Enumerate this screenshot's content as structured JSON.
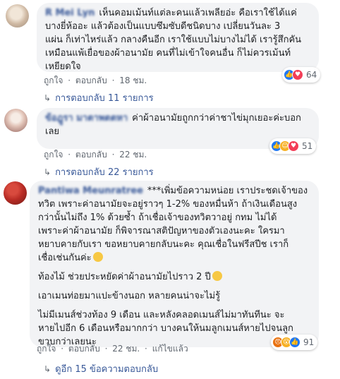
{
  "comments": [
    {
      "author": "R Mei Lyn",
      "lines": [
        "เห็นคอมเม้นท์แต่ละคนแล้วเพลียอ่ะ คือเราใช้ได้แค่",
        "บางยี่ห้ออะ แล้วต้องเป็นแบบซึมซับดีชนิดบาง เปลี่ยนวันละ 3",
        "แผ่น ก็เท่าไหร่แล้ว กลางคืนอีก เราใช้แบบไม่บางไม่ได้ เรารู้สึกคัน",
        "เหมือนแพ้เยื่อของผ้าอนามัย คนที่ไม่เข้าใจคนอื่น ก็ไม่ควรเม้นท์",
        "เหยียดใจ"
      ],
      "meta": [
        "ถูกใจ",
        "·",
        "ตอบกลับ",
        "·",
        "18 ชม."
      ],
      "reactions": {
        "count": "64",
        "icons": [
          "like-icon",
          "love-icon"
        ]
      },
      "reply_link": "การตอบกลับ 11 รายการ"
    },
    {
      "author": "ข้อฎูรา มาตาพตตหา",
      "lines": [
        "ค่าผ้าอนามัยถูกกว่าค่าชาไข่มุกเยอะค่ะบอก",
        "เลย"
      ],
      "meta": [
        "ถูกใจ",
        "·",
        "ตอบกลับ",
        "·",
        "22 ชม."
      ],
      "reactions": {
        "count": "51",
        "icons": [
          "like-icon",
          "haha-icon",
          "love-icon"
        ]
      },
      "reply_link": "การตอบกลับ 22 รายการ"
    },
    {
      "author": "Pantiwa Meunratree",
      "paragraphs": [
        [
          "***เพิ่มข้อความหน่อย เราประชดเจ้าของ",
          "ทวิต เพราะค่าอนามัยจะอยู่ราวๆ 1-2% ของหมื่นห้า ถ้าเงินเดือนสูง",
          "กว่านั้นไม่ถึง 1% ด้วยซ้ำ ถ้าเชื่อเจ้าของทวิตวาอยู่ กทม ไม่ได้",
          "เพราะค่าผ้าอนามัย ก็พิจารณาสติปัญหาของตัวเองนะคะ ใครมา",
          "หยาบคายกับเรา ขอหยาบคายกลับนะคะ คุณเชื่อในฟรีสปีช เราก็",
          "เชื่อเช่นกันค่ะ"
        ],
        [
          "ท้องไม้ ช่วยประหยัดค่าผ้าอนามัยไปราว 2 ปี"
        ],
        [
          "เอาเมนท่อยมาแปะข้างนอก หลายคนน่าจะไม่รู้"
        ],
        [
          "ไม่มีเมนส์ช่วงท้อง 9 เดือน และหลังคลอดเมนส์ไม่มาทันทีนะ จะ",
          "หายไปอีก 6 เดือนหรือมากกว่า บางคนให้นมลูกเมนส์หายไปจนลูก",
          "ขวบกว่าเลยนะ"
        ]
      ],
      "meta": [
        "ถูกใจ",
        "·",
        "ตอบกลับ",
        "·",
        "22 ชม.",
        "·",
        "แก้ไขแล้ว"
      ],
      "reactions": {
        "count": "91",
        "icons": [
          "angry-icon",
          "wow-icon",
          "like-icon"
        ]
      },
      "reply_link": "ดูอีก 15 ข้อความตอบกลับ"
    }
  ],
  "colors": {
    "link": "#385898",
    "bubble": "#f2f3f5",
    "meta": "#606770",
    "like": "#2078f4",
    "love": "#f33e58",
    "haha": "#f7b125",
    "angry": "#e9710f"
  }
}
